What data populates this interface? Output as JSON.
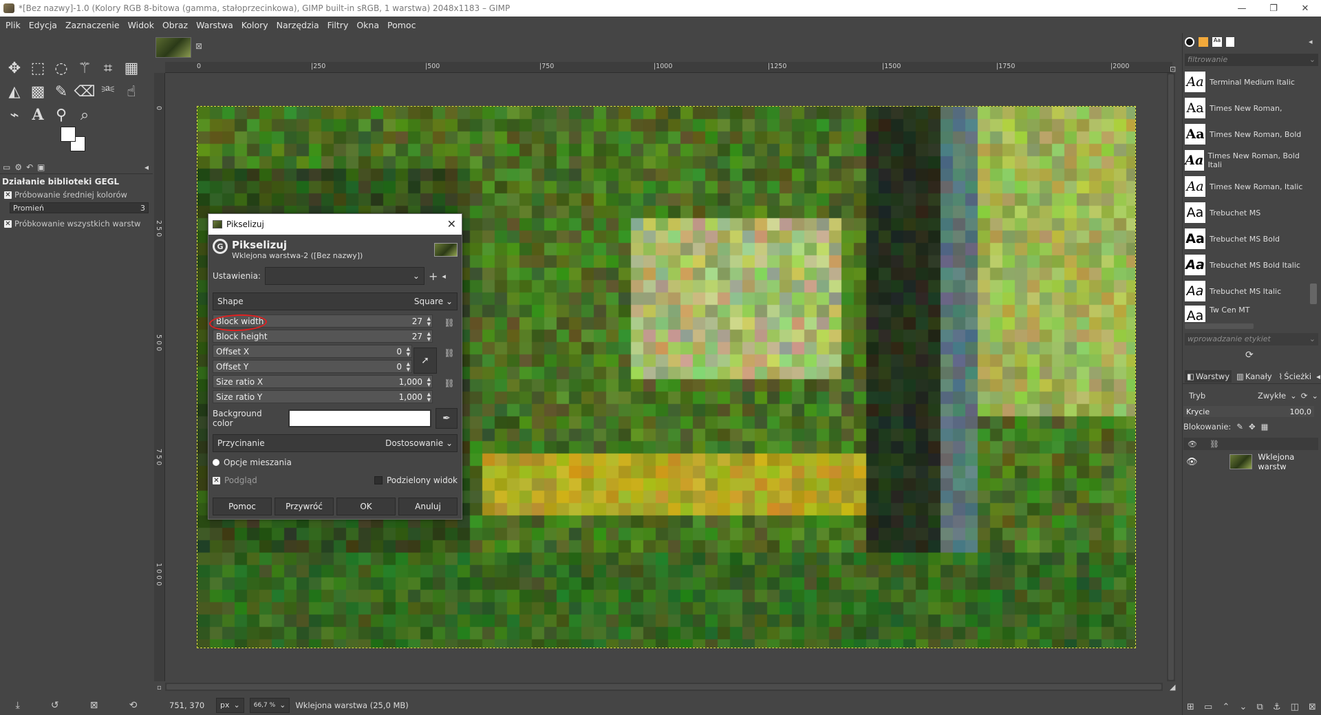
{
  "window": {
    "title": "*[Bez nazwy]-1.0 (Kolory RGB 8-bitowa (gamma, stałoprzecinkowa), GIMP built-in sRGB, 1 warstwa) 2048x1183 – GIMP",
    "controls": [
      "—",
      "❐",
      "✕"
    ]
  },
  "menu": [
    "Plik",
    "Edycja",
    "Zaznaczenie",
    "Widok",
    "Obraz",
    "Warstwa",
    "Kolory",
    "Narzędzia",
    "Filtry",
    "Okna",
    "Pomoc"
  ],
  "toolbox": {
    "tools": [
      "move-icon",
      "rect-select-icon",
      "lasso-icon",
      "fuzzy-select-icon",
      "crop-icon",
      "transform-icon",
      "bucket-fill-icon",
      "gradient-icon",
      "paintbrush-icon",
      "eraser-icon",
      "clone-icon",
      "smudge-icon",
      "paths-icon",
      "text-icon",
      "color-picker-icon",
      "zoom-icon"
    ],
    "options_title": "Działanie biblioteki GEGL",
    "sample_average": "Próbowanie średniej kolorów",
    "radius_label": "Promień",
    "radius_value": "3",
    "sample_merged": "Próbkowanie wszystkich warstw"
  },
  "ruler": {
    "top": [
      "0",
      "|250",
      "|500",
      "|750",
      "|1000",
      "|1250",
      "|1500",
      "|1750",
      "|2000"
    ],
    "left": [
      "0",
      "2 5 0",
      "5 0 0",
      "7 5 0",
      "1 0 0 0"
    ]
  },
  "status": {
    "coords": "751, 370",
    "unit": "px",
    "zoom": "66,7 %",
    "layer_info": "Wklejona warstwa (25,0 MB)"
  },
  "dialog": {
    "window_title": "Pikselizuj",
    "title": "Pikselizuj",
    "subtitle": "Wklejona warstwa-2 ([Bez nazwy])",
    "settings_label": "Ustawienia:",
    "settings_value": "",
    "shape_label": "Shape",
    "shape_value": "Square",
    "block_width_label": "Block width",
    "block_width_value": "27",
    "block_height_label": "Block height",
    "block_height_value": "27",
    "offset_x_label": "Offset X",
    "offset_x_value": "0",
    "offset_y_label": "Offset Y",
    "offset_y_value": "0",
    "size_ratio_x_label": "Size ratio X",
    "size_ratio_x_value": "1,000",
    "size_ratio_y_label": "Size ratio Y",
    "size_ratio_y_value": "1,000",
    "bg_color_label": "Background color",
    "bg_color": "#ffffff",
    "clipping_label": "Przycinanie",
    "clipping_value": "Dostosowanie",
    "blend_options": "Opcje mieszania",
    "preview": "Podgląd",
    "split_view": "Podzielony widok",
    "btn_help": "Pomoc",
    "btn_reset": "Przywróć",
    "btn_ok": "OK",
    "btn_cancel": "Anuluj"
  },
  "fonts": {
    "filter_placeholder": "filtrowanie",
    "items": [
      "Terminal Medium Italic",
      "Times New Roman,",
      "Times New Roman, Bold",
      "Times New Roman, Bold Itali",
      "Times New Roman, Italic",
      "Trebuchet MS",
      "Trebuchet MS Bold",
      "Trebuchet MS Bold Italic",
      "Trebuchet MS Italic",
      "Tw Cen MT"
    ],
    "sample": "Aa",
    "tag_placeholder": "wprowadzanie etykiet"
  },
  "layers": {
    "tabs": [
      "Warstwy",
      "Kanały",
      "Ścieżki"
    ],
    "mode_label": "Tryb",
    "mode_value": "Zwykłe",
    "opacity_label": "Krycie",
    "opacity_value": "100,0",
    "lock_label": "Blokowanie:",
    "layer_name": "Wklejona warstw"
  },
  "colors": {
    "accent_selection": "#dede40",
    "highlight_red": "#e02020"
  }
}
